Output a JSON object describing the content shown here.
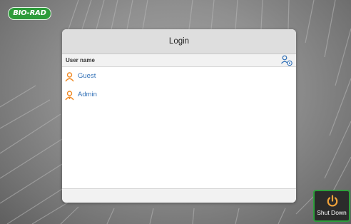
{
  "brand": {
    "logo_text": "BIO-RAD",
    "color": "#2d9b3a"
  },
  "login_dialog": {
    "title": "Login",
    "column_header": "User name",
    "header_icon": "user-settings-icon",
    "users": [
      {
        "name": "Guest",
        "icon": "user-icon"
      },
      {
        "name": "Admin",
        "icon": "admin-user-icon"
      }
    ]
  },
  "shutdown": {
    "label": "Shut Down",
    "icon": "power-icon"
  },
  "colors": {
    "accent": "#2e9e3c",
    "link": "#2f6fb6",
    "user_icon": "#f08a24"
  }
}
